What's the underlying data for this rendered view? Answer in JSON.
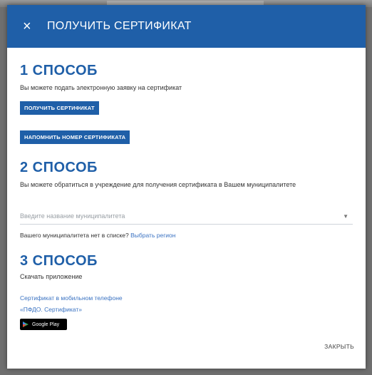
{
  "dialog": {
    "title": "ПОЛУЧИТЬ СЕРТИФИКАТ",
    "close_icon": "×",
    "close_label": "ЗАКРЫТЬ"
  },
  "method1": {
    "title": "1 СПОСОБ",
    "description": "Вы можете подать электронную заявку на сертификат",
    "get_button": "ПОЛУЧИТЬ СЕРТИФИКАТ",
    "remind_button": "НАПОМНИТЬ НОМЕР СЕРТИФИКАТА"
  },
  "method2": {
    "title": "2 СПОСОБ",
    "description": "Вы можете обратиться в учреждение для получения сертификата в Вашем муниципалитете",
    "municipality_placeholder": "Введите название муниципалитета",
    "hint_text": "Вашего муниципалитета нет в списке?",
    "region_link": "Выбрать регион"
  },
  "method3": {
    "title": "3 СПОСОБ",
    "description": "Скачать приложение",
    "link1": "Сертификат в мобильном телефоне",
    "link2": "«ПФДО. Сертификат»",
    "store_badge": "Google Play"
  },
  "colors": {
    "brand": "#1f5fa8",
    "link": "#3b73c2"
  },
  "icons": [
    "close-icon",
    "chevron-down-icon",
    "google-play-icon"
  ]
}
